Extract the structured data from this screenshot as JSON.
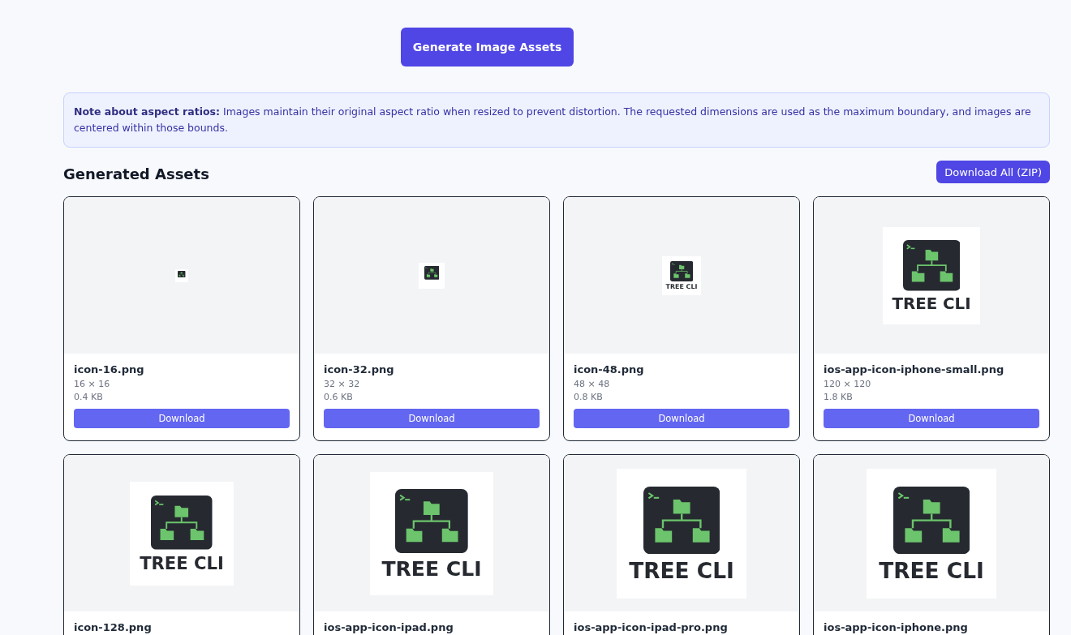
{
  "generate_button": "Generate Image Assets",
  "note": "**Note about aspect ratios:** Images maintain their original aspect ratio when resized to prevent distortion. The requested dimensions are used as the maximum boundary, and images are centered within those bounds.",
  "section_title": "Generated Assets",
  "download_all_button": "Download All (ZIP)",
  "assets": [
    {
      "name": "icon-16.png",
      "kind": "tiny",
      "dimensions": "16 × 16",
      "size": "0.4 KB",
      "button": "Download"
    },
    {
      "name": "icon-32.png",
      "kind": "small",
      "dimensions": "32 × 32",
      "size": "0.6 KB",
      "button": "Download"
    },
    {
      "name": "icon-48.png",
      "kind": "medium",
      "dimensions": "48 × 48",
      "size": "0.8 KB",
      "button": "Download",
      "logo_text": "TREE CLI"
    },
    {
      "name": "ios-app-icon-iphone-small.png",
      "kind": "large",
      "dimensions": "120 × 120",
      "size": "1.8 KB",
      "button": "Download",
      "logo_text": "TREE CLI"
    },
    {
      "name": "icon-128.png",
      "kind": "larger",
      "logo_text": "TREE CLI"
    },
    {
      "name": "ios-app-icon-ipad.png",
      "kind": "huge",
      "logo_text": "TREE CLI"
    },
    {
      "name": "ios-app-icon-ipad-pro.png",
      "kind": "full",
      "logo_text": "TREE CLI"
    },
    {
      "name": "ios-app-icon-iphone.png",
      "kind": "full",
      "logo_text": "TREE CLI"
    }
  ]
}
